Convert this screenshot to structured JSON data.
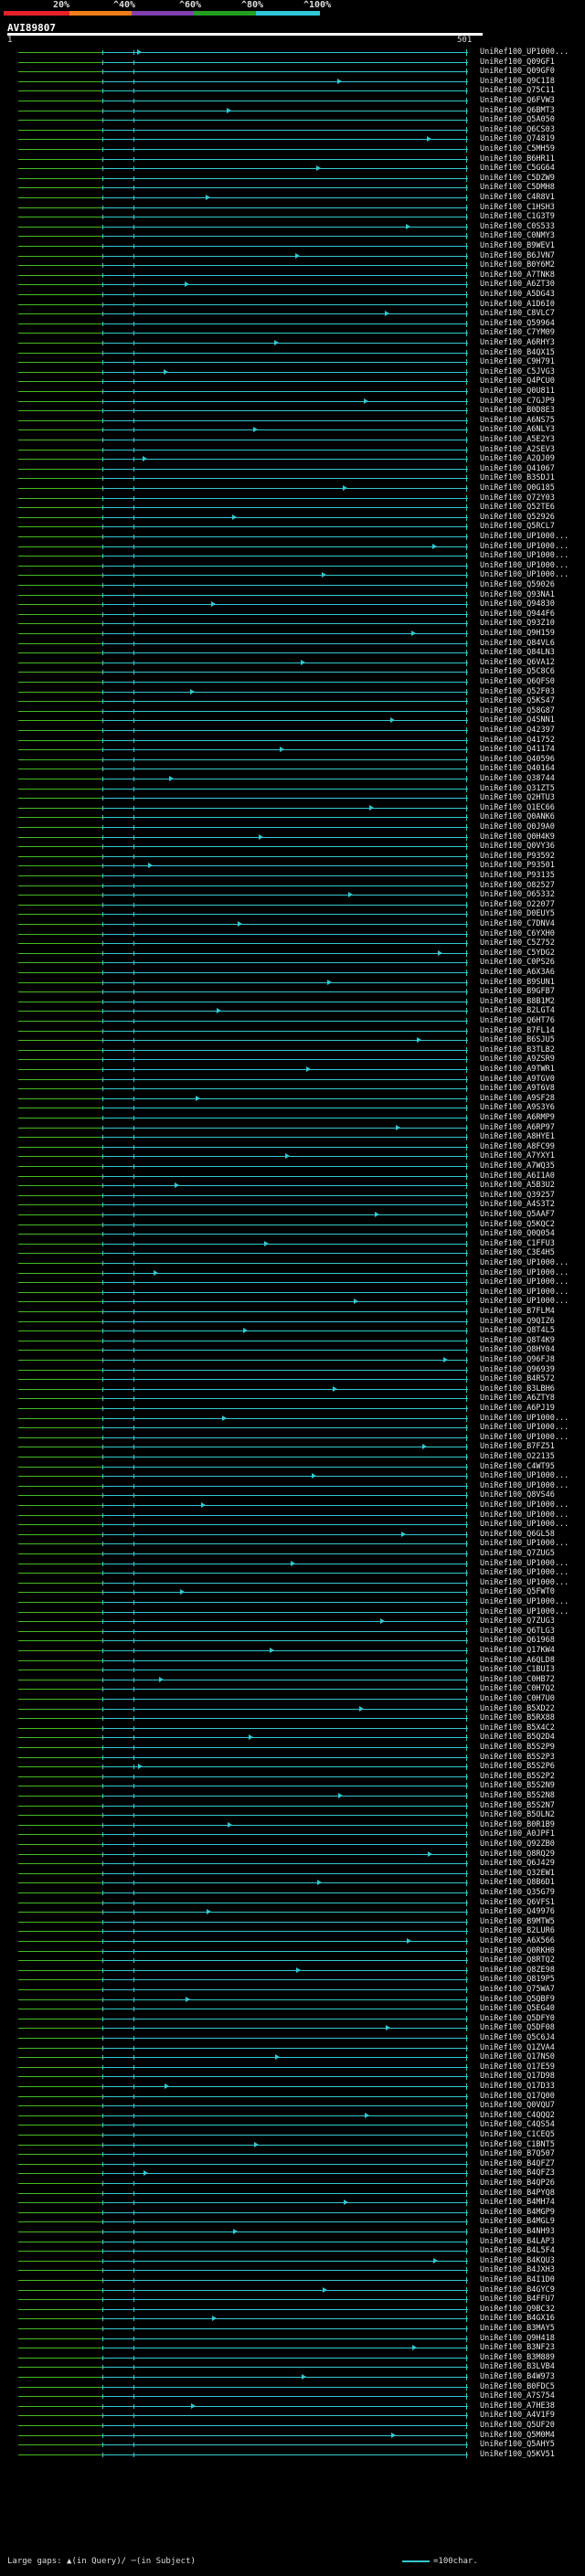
{
  "header": {
    "percent_labels": [
      "20%",
      "^40%",
      "^60%",
      "^80%",
      "^100%"
    ],
    "band_colors": [
      "#e8202a",
      "#ef7f1a",
      "#8040b0",
      "#22a020",
      "#2fc8d8"
    ],
    "query_id": "AVI89807",
    "query_start": "1",
    "query_end": "501"
  },
  "hits": [
    "UniRef100_UP1000...",
    "UniRef100_Q09GF1",
    "UniRef100_Q09GF0",
    "UniRef100_Q9C1I8",
    "UniRef100_Q75C11",
    "UniRef100_Q6FVW3",
    "UniRef100_Q6BMT3",
    "UniRef100_Q5A050",
    "UniRef100_Q6CS03",
    "UniRef100_Q74819",
    "UniRef100_C5MH59",
    "UniRef100_B6HR11",
    "UniRef100_C5GG64",
    "UniRef100_C5DZW9",
    "UniRef100_C5DMH8",
    "UniRef100_C4R8V1",
    "UniRef100_C1HSH3",
    "UniRef100_C1G3T9",
    "UniRef100_C0S533",
    "UniRef100_C0NMY3",
    "UniRef100_B9WEV1",
    "UniRef100_B6JVN7",
    "UniRef100_B0Y6M2",
    "UniRef100_A7TNK8",
    "UniRef100_A6ZT30",
    "UniRef100_A5DG43",
    "UniRef100_A1D6I0",
    "UniRef100_C8VLC7",
    "UniRef100_Q59964",
    "UniRef100_C7YM09",
    "UniRef100_A6RHY3",
    "UniRef100_B4QX15",
    "UniRef100_C9H791",
    "UniRef100_C5JVG3",
    "UniRef100_Q4PCU0",
    "UniRef100_Q0U811",
    "UniRef100_C7GJP9",
    "UniRef100_B0D8E3",
    "UniRef100_A6NS75",
    "UniRef100_A6NLY3",
    "UniRef100_A5E2Y3",
    "UniRef100_A2SEV3",
    "UniRef100_A2QJ09",
    "UniRef100_Q41067",
    "UniRef100_B3SDJ1",
    "UniRef100_Q0G185",
    "UniRef100_Q72Y03",
    "UniRef100_Q52TE6",
    "UniRef100_Q52926",
    "UniRef100_Q5RCL7",
    "UniRef100_UP1000...",
    "UniRef100_UP1000...",
    "UniRef100_UP1000...",
    "UniRef100_UP1000...",
    "UniRef100_UP1000...",
    "UniRef100_Q59026",
    "UniRef100_Q93NA1",
    "UniRef100_Q94830",
    "UniRef100_Q944F6",
    "UniRef100_Q93Z10",
    "UniRef100_Q9H159",
    "UniRef100_Q84VL6",
    "UniRef100_Q84LN3",
    "UniRef100_Q6VA12",
    "UniRef100_Q5C8C6",
    "UniRef100_Q6QFS0",
    "UniRef100_Q52F03",
    "UniRef100_Q5KS47",
    "UniRef100_Q58G87",
    "UniRef100_Q4SNN1",
    "UniRef100_Q42397",
    "UniRef100_Q41752",
    "UniRef100_Q41174",
    "UniRef100_Q40596",
    "UniRef100_Q40164",
    "UniRef100_Q38744",
    "UniRef100_Q31ZT5",
    "UniRef100_Q2HTU3",
    "UniRef100_Q1EC66",
    "UniRef100_Q0ANK6",
    "UniRef100_Q0J9A0",
    "UniRef100_Q0H4K9",
    "UniRef100_Q0VY36",
    "UniRef100_P93592",
    "UniRef100_P93501",
    "UniRef100_P93135",
    "UniRef100_O82527",
    "UniRef100_O65332",
    "UniRef100_O22077",
    "UniRef100_D0EUY5",
    "UniRef100_C7DNV4",
    "UniRef100_C6YXH0",
    "UniRef100_C5Z752",
    "UniRef100_C5YDG2",
    "UniRef100_C0PS26",
    "UniRef100_A6X3A6",
    "UniRef100_B9SUN1",
    "UniRef100_B9GFB7",
    "UniRef100_B8B1M2",
    "UniRef100_B2LGT4",
    "UniRef100_Q6HT76",
    "UniRef100_B7FL14",
    "UniRef100_B6SJU5",
    "UniRef100_B3TLB2",
    "UniRef100_A9ZSR9",
    "UniRef100_A9TWR1",
    "UniRef100_A9TGV0",
    "UniRef100_A9T6V8",
    "UniRef100_A9SF28",
    "UniRef100_A9S3Y6",
    "UniRef100_A6RMP9",
    "UniRef100_A6RP97",
    "UniRef100_A8HYE1",
    "UniRef100_A8FC99",
    "UniRef100_A7YXY1",
    "UniRef100_A7WQ35",
    "UniRef100_A6I1A0",
    "UniRef100_A5B3U2",
    "UniRef100_Q39257",
    "UniRef100_A4S3T2",
    "UniRef100_Q5AAF7",
    "UniRef100_Q5KQC2",
    "UniRef100_Q0Q054",
    "UniRef100_C1FFU3",
    "UniRef100_C3E4H5",
    "UniRef100_UP1000...",
    "UniRef100_UP1000...",
    "UniRef100_UP1000...",
    "UniRef100_UP1000...",
    "UniRef100_UP1000...",
    "UniRef100_B7FLM4",
    "UniRef100_Q9QIZ6",
    "UniRef100_Q8T4L5",
    "UniRef100_Q8T4K9",
    "UniRef100_Q8HY04",
    "UniRef100_Q96FJ8",
    "UniRef100_Q96939",
    "UniRef100_B4R572",
    "UniRef100_B3LBH6",
    "UniRef100_A6ZTY8",
    "UniRef100_A6PJ19",
    "UniRef100_UP1000...",
    "UniRef100_UP1000...",
    "UniRef100_UP1000...",
    "UniRef100_B7FZ51",
    "UniRef100_O22135",
    "UniRef100_C4WT95",
    "UniRef100_UP1000...",
    "UniRef100_UP1000...",
    "UniRef100_Q8VS46",
    "UniRef100_UP1000...",
    "UniRef100_UP1000...",
    "UniRef100_UP1000...",
    "UniRef100_Q6GL58",
    "UniRef100_UP1000...",
    "UniRef100_Q7ZUG5",
    "UniRef100_UP1000...",
    "UniRef100_UP1000...",
    "UniRef100_UP1000...",
    "UniRef100_Q5FWT0",
    "UniRef100_UP1000...",
    "UniRef100_UP1000...",
    "UniRef100_Q7ZUG3",
    "UniRef100_Q6TLG3",
    "UniRef100_Q61968",
    "UniRef100_Q17KW4",
    "UniRef100_A6QLD8",
    "UniRef100_C1BUI3",
    "UniRef100_C0HB72",
    "UniRef100_C0H7Q2",
    "UniRef100_C0H7U0",
    "UniRef100_B5XD22",
    "UniRef100_B5RX88",
    "UniRef100_B5X4C2",
    "UniRef100_B5Q2D4",
    "UniRef100_B5S2P9",
    "UniRef100_B5S2P3",
    "UniRef100_B5S2P6",
    "UniRef100_B5S2P2",
    "UniRef100_B5S2N9",
    "UniRef100_B5S2N8",
    "UniRef100_B5S2N7",
    "UniRef100_B5OLN2",
    "UniRef100_B0R1B9",
    "UniRef100_A0JPF1",
    "UniRef100_Q92ZB0",
    "UniRef100_Q8RQ29",
    "UniRef100_Q6J429",
    "UniRef100_Q32EW1",
    "UniRef100_Q8B6D1",
    "UniRef100_Q35G79",
    "UniRef100_Q6VFS1",
    "UniRef100_Q49976",
    "UniRef100_B9MTW5",
    "UniRef100_B2LUR6",
    "UniRef100_A6X566",
    "UniRef100_Q0RKH0",
    "UniRef100_Q8RTQ2",
    "UniRef100_Q8ZE98",
    "UniRef100_Q819P5",
    "UniRef100_Q75WA7",
    "UniRef100_Q5QBF9",
    "UniRef100_Q5EG40",
    "UniRef100_Q5DFY0",
    "UniRef100_Q5DF08",
    "UniRef100_Q5C6J4",
    "UniRef100_Q1ZVA4",
    "UniRef100_Q17NS0",
    "UniRef100_Q17E59",
    "UniRef100_Q17D98",
    "UniRef100_Q17D33",
    "UniRef100_Q17Q00",
    "UniRef100_Q0VQU7",
    "UniRef100_C4QQQ2",
    "UniRef100_C4QS54",
    "UniRef100_C1CEQ5",
    "UniRef100_C1BNT5",
    "UniRef100_B7Q507",
    "UniRef100_B4QFZ7",
    "UniRef100_B4QFZ3",
    "UniRef100_B4QP26",
    "UniRef100_B4PYQ8",
    "UniRef100_B4MH74",
    "UniRef100_B4MGP9",
    "UniRef100_B4MGL9",
    "UniRef100_B4NH93",
    "UniRef100_B4LAP3",
    "UniRef100_B4L5F4",
    "UniRef100_B4KQU3",
    "UniRef100_B4JXH3",
    "UniRef100_B4I1D0",
    "UniRef100_B4GYC9",
    "UniRef100_B4FFU7",
    "UniRef100_Q9BC32",
    "UniRef100_B4GX16",
    "UniRef100_B3MAY5",
    "UniRef100_Q9H418",
    "UniRef100_B3NF23",
    "UniRef100_B3M889",
    "UniRef100_B3LVB4",
    "UniRef100_B4W973",
    "UniRef100_B0FDC5",
    "UniRef100_A7S754",
    "UniRef100_A7HE38",
    "UniRef100_A4V1F9",
    "UniRef100_Q5UF20",
    "UniRef100_Q5M0M4",
    "UniRef100_Q5AHY5",
    "UniRef100_Q5KV51"
  ],
  "footer": {
    "gaps_label": "Large gaps:",
    "gaps_in_query": "▲(in Query)/",
    "gaps_in_subject": "─(in Subject)",
    "scale_label": "=100char."
  }
}
